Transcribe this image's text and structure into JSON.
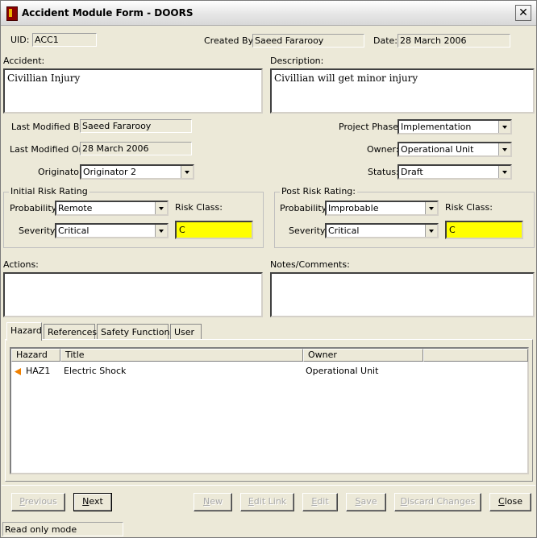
{
  "window": {
    "title": "Accident Module Form - DOORS",
    "close_glyph": "✕"
  },
  "header": {
    "uid_label": "UID:",
    "uid_value": "ACC1",
    "created_by_label": "Created By:",
    "created_by_value": "Saeed Fararooy",
    "date_label": "Date:",
    "date_value": "28 March 2006"
  },
  "accident": {
    "label": "Accident:",
    "value": "Civillian Injury"
  },
  "description": {
    "label": "Description:",
    "value": "Civillian will get minor injury"
  },
  "meta": {
    "last_modified_by_label": "Last Modified By:",
    "last_modified_by_value": "Saeed Fararooy",
    "last_modified_on_label": "Last Modified On:",
    "last_modified_on_value": "28 March 2006",
    "originator_label": "Originator:",
    "originator_value": "Originator 2",
    "project_phase_label": "Project Phase:",
    "project_phase_value": "Implementation",
    "owner_label": "Owner:",
    "owner_value": "Operational Unit",
    "status_label": "Status:",
    "status_value": "Draft"
  },
  "initial_risk": {
    "title": "Initial Risk Rating",
    "probability_label": "Probability:",
    "probability_value": "Remote",
    "severity_label": "Severity:",
    "severity_value": "Critical",
    "risk_class_label": "Risk Class:",
    "risk_class_value": "C"
  },
  "post_risk": {
    "title": "Post Risk Rating:",
    "probability_label": "Probability:",
    "probability_value": "Improbable",
    "severity_label": "Severity:",
    "severity_value": "Critical",
    "risk_class_label": "Risk Class:",
    "risk_class_value": "C"
  },
  "actions": {
    "label": "Actions:"
  },
  "notes": {
    "label": "Notes/Comments:"
  },
  "tabs": [
    {
      "label": "Hazard"
    },
    {
      "label": "References"
    },
    {
      "label": "Safety Functions"
    },
    {
      "label": "User"
    }
  ],
  "hazard_table": {
    "columns": [
      "Hazard",
      "Title",
      "Owner"
    ],
    "rows": [
      {
        "hazard": "HAZ1",
        "title": "Electric Shock",
        "owner": "Operational Unit"
      }
    ]
  },
  "buttons": {
    "previous": {
      "first": "P",
      "rest": "revious"
    },
    "next": {
      "first": "N",
      "rest": "ext"
    },
    "new": {
      "first": "N",
      "rest": "ew"
    },
    "edit_link": {
      "first": "E",
      "rest": "dit Link"
    },
    "edit": {
      "first": "E",
      "rest": "dit"
    },
    "save": {
      "first": "S",
      "rest": "ave"
    },
    "discard": {
      "first": "D",
      "rest": "iscard Changes"
    },
    "close": {
      "first": "C",
      "rest": "lose"
    }
  },
  "status_bar": {
    "text": "Read only mode"
  },
  "colors": {
    "risk_class_bg": "#ffff00",
    "row_marker": "#f08000"
  }
}
